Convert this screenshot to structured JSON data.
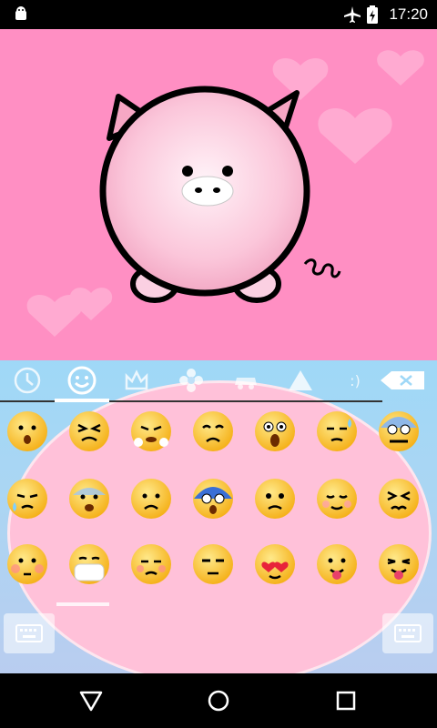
{
  "status_bar": {
    "time": "17:20",
    "icons": [
      "android-icon",
      "airplane-mode-icon",
      "battery-charging-icon"
    ]
  },
  "wallpaper": {
    "subject": "pink-pig-illustration"
  },
  "keyboard": {
    "tabs": [
      {
        "name": "recent-tab",
        "icon": "clock-icon"
      },
      {
        "name": "smiley-tab",
        "icon": "smiley-icon",
        "active": true
      },
      {
        "name": "crown-tab",
        "icon": "crown-icon"
      },
      {
        "name": "flower-tab",
        "icon": "flower-icon"
      },
      {
        "name": "car-tab",
        "icon": "car-icon"
      },
      {
        "name": "triangle-tab",
        "icon": "triangle-icon"
      },
      {
        "name": "symbol-tab",
        "icon": "smile-text-icon",
        "label": ":)"
      }
    ],
    "emoji_rows": [
      [
        "😮",
        "😣",
        "😤",
        "😩",
        "😱",
        "😥",
        "😖"
      ],
      [
        "😪",
        "😰",
        "😟",
        "😨",
        "😟",
        "😌",
        "😣"
      ],
      [
        "😳",
        "😷",
        "😞",
        "😒",
        "😍",
        "😋",
        "😝"
      ]
    ],
    "accent": "#ffc1d9"
  },
  "nav_bar": {
    "icons": [
      "back-icon",
      "home-icon",
      "recents-icon"
    ]
  }
}
